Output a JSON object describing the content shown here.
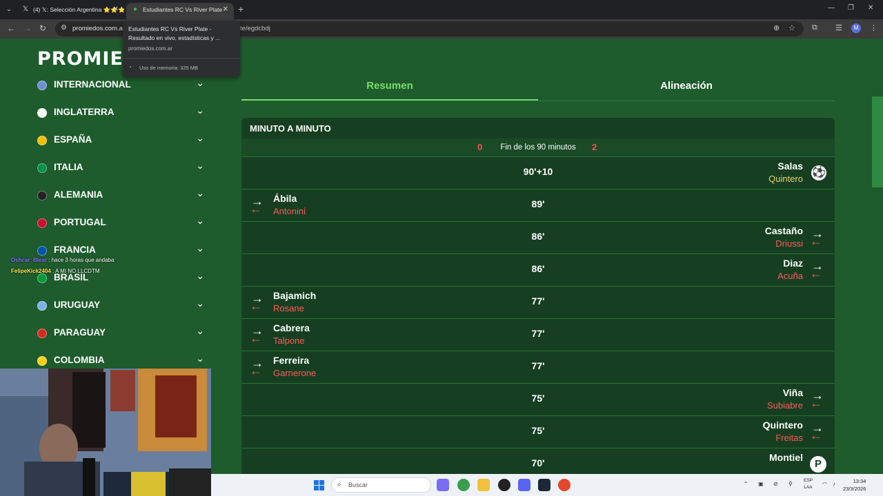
{
  "browser": {
    "tabs": [
      {
        "title": "(4) 𝕏: Selección Argentina ⭐⭐⭐",
        "favicon": "x-logo"
      },
      {
        "title": "Estudiantes RC Vs River Plate -",
        "favicon": "promiedos-logo"
      }
    ],
    "address_host": "promiedos.com.ar",
    "address_rest": "te/egdcbdj",
    "tooltip": {
      "title": "Estudiantes RC Vs River Plate - Resultado en vivo, estadísticas y ...",
      "host": "promiedos.com.ar",
      "memory": "Uso de memoria: 325 MB"
    }
  },
  "site": {
    "logo": "PROMIE",
    "countries": [
      {
        "name": "INTERNACIONAL",
        "flag": "#6d8fd0"
      },
      {
        "name": "INGLATERRA",
        "flag": "#ffffff"
      },
      {
        "name": "ESPAÑA",
        "flag": "#f1bf00"
      },
      {
        "name": "ITALIA",
        "flag": "#009246"
      },
      {
        "name": "ALEMANIA",
        "flag": "#222222"
      },
      {
        "name": "PORTUGAL",
        "flag": "#c8102e"
      },
      {
        "name": "FRANCIA",
        "flag": "#0055a4"
      },
      {
        "name": "BRASIL",
        "flag": "#009c3b"
      },
      {
        "name": "URUGUAY",
        "flag": "#7bb3e8"
      },
      {
        "name": "PARAGUAY",
        "flag": "#d52b1e"
      },
      {
        "name": "COLOMBIA",
        "flag": "#fcd116"
      }
    ],
    "tabs": {
      "resumen": "Resumen",
      "alineacion": "Alineación"
    },
    "panel_title": "MINUTO A MINUTO",
    "score": {
      "home": "0",
      "text": "Fin de los 90 minutos",
      "away": "2"
    },
    "events": [
      {
        "minute": "90'+10",
        "side": "right",
        "type": "goal",
        "main": "Salas",
        "secondary": "Quintero"
      },
      {
        "minute": "89'",
        "side": "left",
        "type": "sub",
        "main": "Ábila",
        "secondary": "Antonini"
      },
      {
        "minute": "86'",
        "side": "right",
        "type": "sub",
        "main": "Castaño",
        "secondary": "Driussi"
      },
      {
        "minute": "86'",
        "side": "right",
        "type": "sub",
        "main": "Diaz",
        "secondary": "Acuña"
      },
      {
        "minute": "77'",
        "side": "left",
        "type": "sub",
        "main": "Bajamich",
        "secondary": "Rosane"
      },
      {
        "minute": "77'",
        "side": "left",
        "type": "sub",
        "main": "Cabrera",
        "secondary": "Talpone"
      },
      {
        "minute": "77'",
        "side": "left",
        "type": "sub",
        "main": "Ferreira",
        "secondary": "Garnerone"
      },
      {
        "minute": "75'",
        "side": "right",
        "type": "sub",
        "main": "Viña",
        "secondary": "Subiabre"
      },
      {
        "minute": "75'",
        "side": "right",
        "type": "sub",
        "main": "Quintero",
        "secondary": "Freitas"
      },
      {
        "minute": "70'",
        "side": "right",
        "type": "penalty",
        "main": "Montiel",
        "secondary": ""
      }
    ]
  },
  "chat": [
    {
      "user": "Oshcar_Blear",
      "message": ": hace 3 horas que andaba"
    },
    {
      "user": "FelipeKick2404",
      "message": ": A MI NO LLCDTM"
    }
  ],
  "taskbar": {
    "search_placeholder": "Buscar",
    "lang_top": "ESP",
    "lang_bottom": "LAA",
    "time": "13:34",
    "date": "23/3/2026"
  },
  "colors": {
    "accent_green": "#7bdc6a",
    "score_red": "#ff4d4d",
    "panel_bg": "#163f21"
  }
}
